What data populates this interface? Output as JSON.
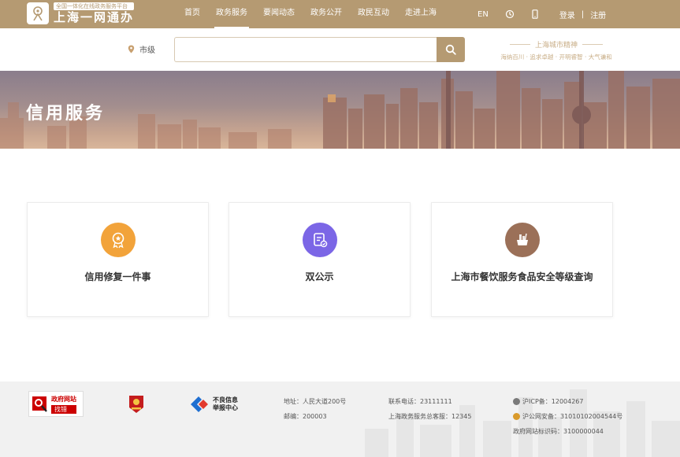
{
  "header": {
    "logo_subtitle": "全国一体化在线政务服务平台",
    "logo_title": "上海一网通办",
    "nav": [
      {
        "label": "首页",
        "active": false
      },
      {
        "label": "政务服务",
        "active": true
      },
      {
        "label": "要闻动态",
        "active": false
      },
      {
        "label": "政务公开",
        "active": false
      },
      {
        "label": "政民互动",
        "active": false
      },
      {
        "label": "走进上海",
        "active": false
      }
    ],
    "lang_label": "EN",
    "accessibility_icon": "accessibility-icon",
    "mobile_icon": "mobile-icon",
    "login_label": "登录",
    "separator": "|",
    "register_label": "注册"
  },
  "search": {
    "location_label": "市级",
    "placeholder": "",
    "value": "",
    "button_icon": "search-icon"
  },
  "slogan": {
    "title": "上海城市精神",
    "subtitle": "海纳百川 · 追求卓越 · 开明睿智 · 大气谦和"
  },
  "banner": {
    "title": "信用服务"
  },
  "cards": [
    {
      "label": "信用修复一件事",
      "icon": "medal-icon",
      "color": "#f2a33a"
    },
    {
      "label": "双公示",
      "icon": "document-icon",
      "color": "#7b66e6"
    },
    {
      "label": "上海市餐饮服务食品安全等级查询",
      "icon": "food-icon",
      "color": "#9b7058"
    }
  ],
  "footer": {
    "badge1_line1": "政府网站",
    "badge1_line2": "找错",
    "badge3_line1": "不良信息",
    "badge3_line2": "举报中心",
    "address": "地址：人民大道200号",
    "postcode": "邮编：200003",
    "phone": "联系电话：23111111",
    "hotline": "上海政务服务总客服：12345",
    "icp": "沪ICP备：12004267",
    "police": "沪公网安备：31010102004544号",
    "gov_id": "政府网站标识码：3100000044"
  },
  "colors": {
    "brand": "#b59a72",
    "card_border": "#ececec",
    "footer_bg": "#f1f1f1"
  }
}
